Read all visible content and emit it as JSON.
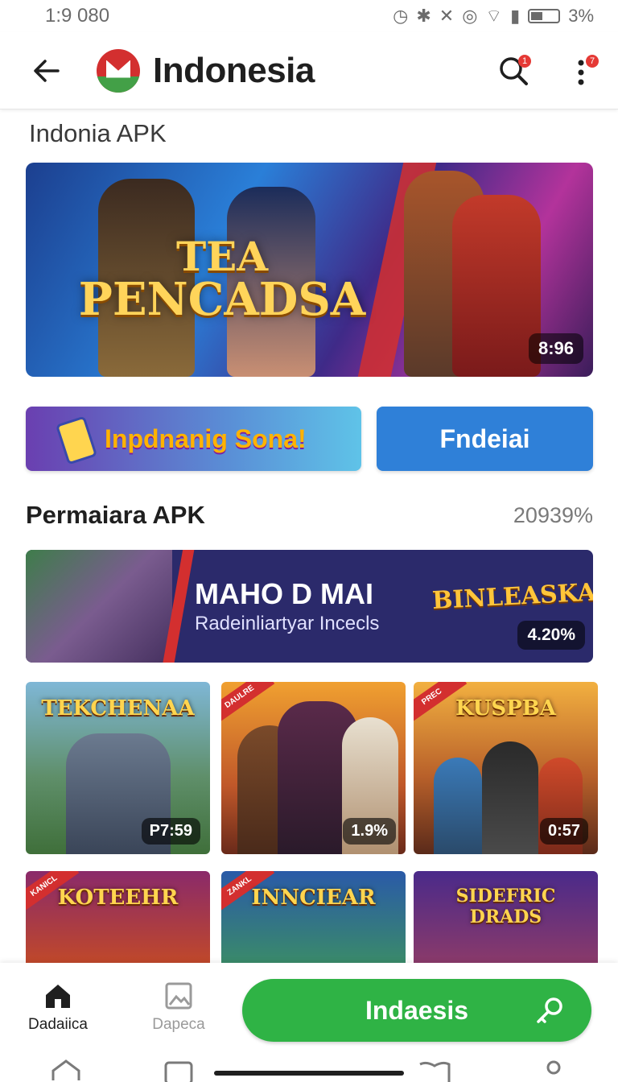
{
  "status_bar": {
    "time": "1:9 080",
    "battery": "3%"
  },
  "app_bar": {
    "title": "Indonesia",
    "search_badge": "1",
    "menu_badge": "7"
  },
  "top_section": {
    "title": "Indonia APK"
  },
  "hero": {
    "title_line1": "TEA",
    "title_line2": "PENCADSA",
    "badge": "8:96"
  },
  "actions": {
    "promo_label": "Inpdnanig Sona!",
    "primary_label": "Fndeiai"
  },
  "popular": {
    "title": "Permaiara APK",
    "meta": "20939%"
  },
  "feature": {
    "title": "MAHO D MAI",
    "subtitle": "Radeinliartyar Incecls",
    "logo_text": "BINLEASKAN",
    "badge": "4.20%"
  },
  "cards": [
    {
      "title": "TEKCHENAA",
      "badge": "P7:59",
      "ribbon": ""
    },
    {
      "title": "",
      "badge": "1.9%",
      "ribbon": "DAULRE"
    },
    {
      "title": "KUSPBA",
      "badge": "0:57",
      "ribbon": "PREC"
    },
    {
      "title": "KOTEEHR",
      "badge": "",
      "ribbon": "KANICL"
    },
    {
      "title": "INNCIEAR",
      "badge": "",
      "ribbon": "ZANKL"
    },
    {
      "title": "SIDEFRIC DRADS",
      "badge": "",
      "ribbon": ""
    }
  ],
  "bottom_nav": {
    "home_label": "Dadaiica",
    "second_label": "Dapeca",
    "cta_label": "Indaesis"
  },
  "colors": {
    "accent_blue": "#2f80d8",
    "cta_green": "#2fb345",
    "brand_red": "#d32f2f"
  }
}
